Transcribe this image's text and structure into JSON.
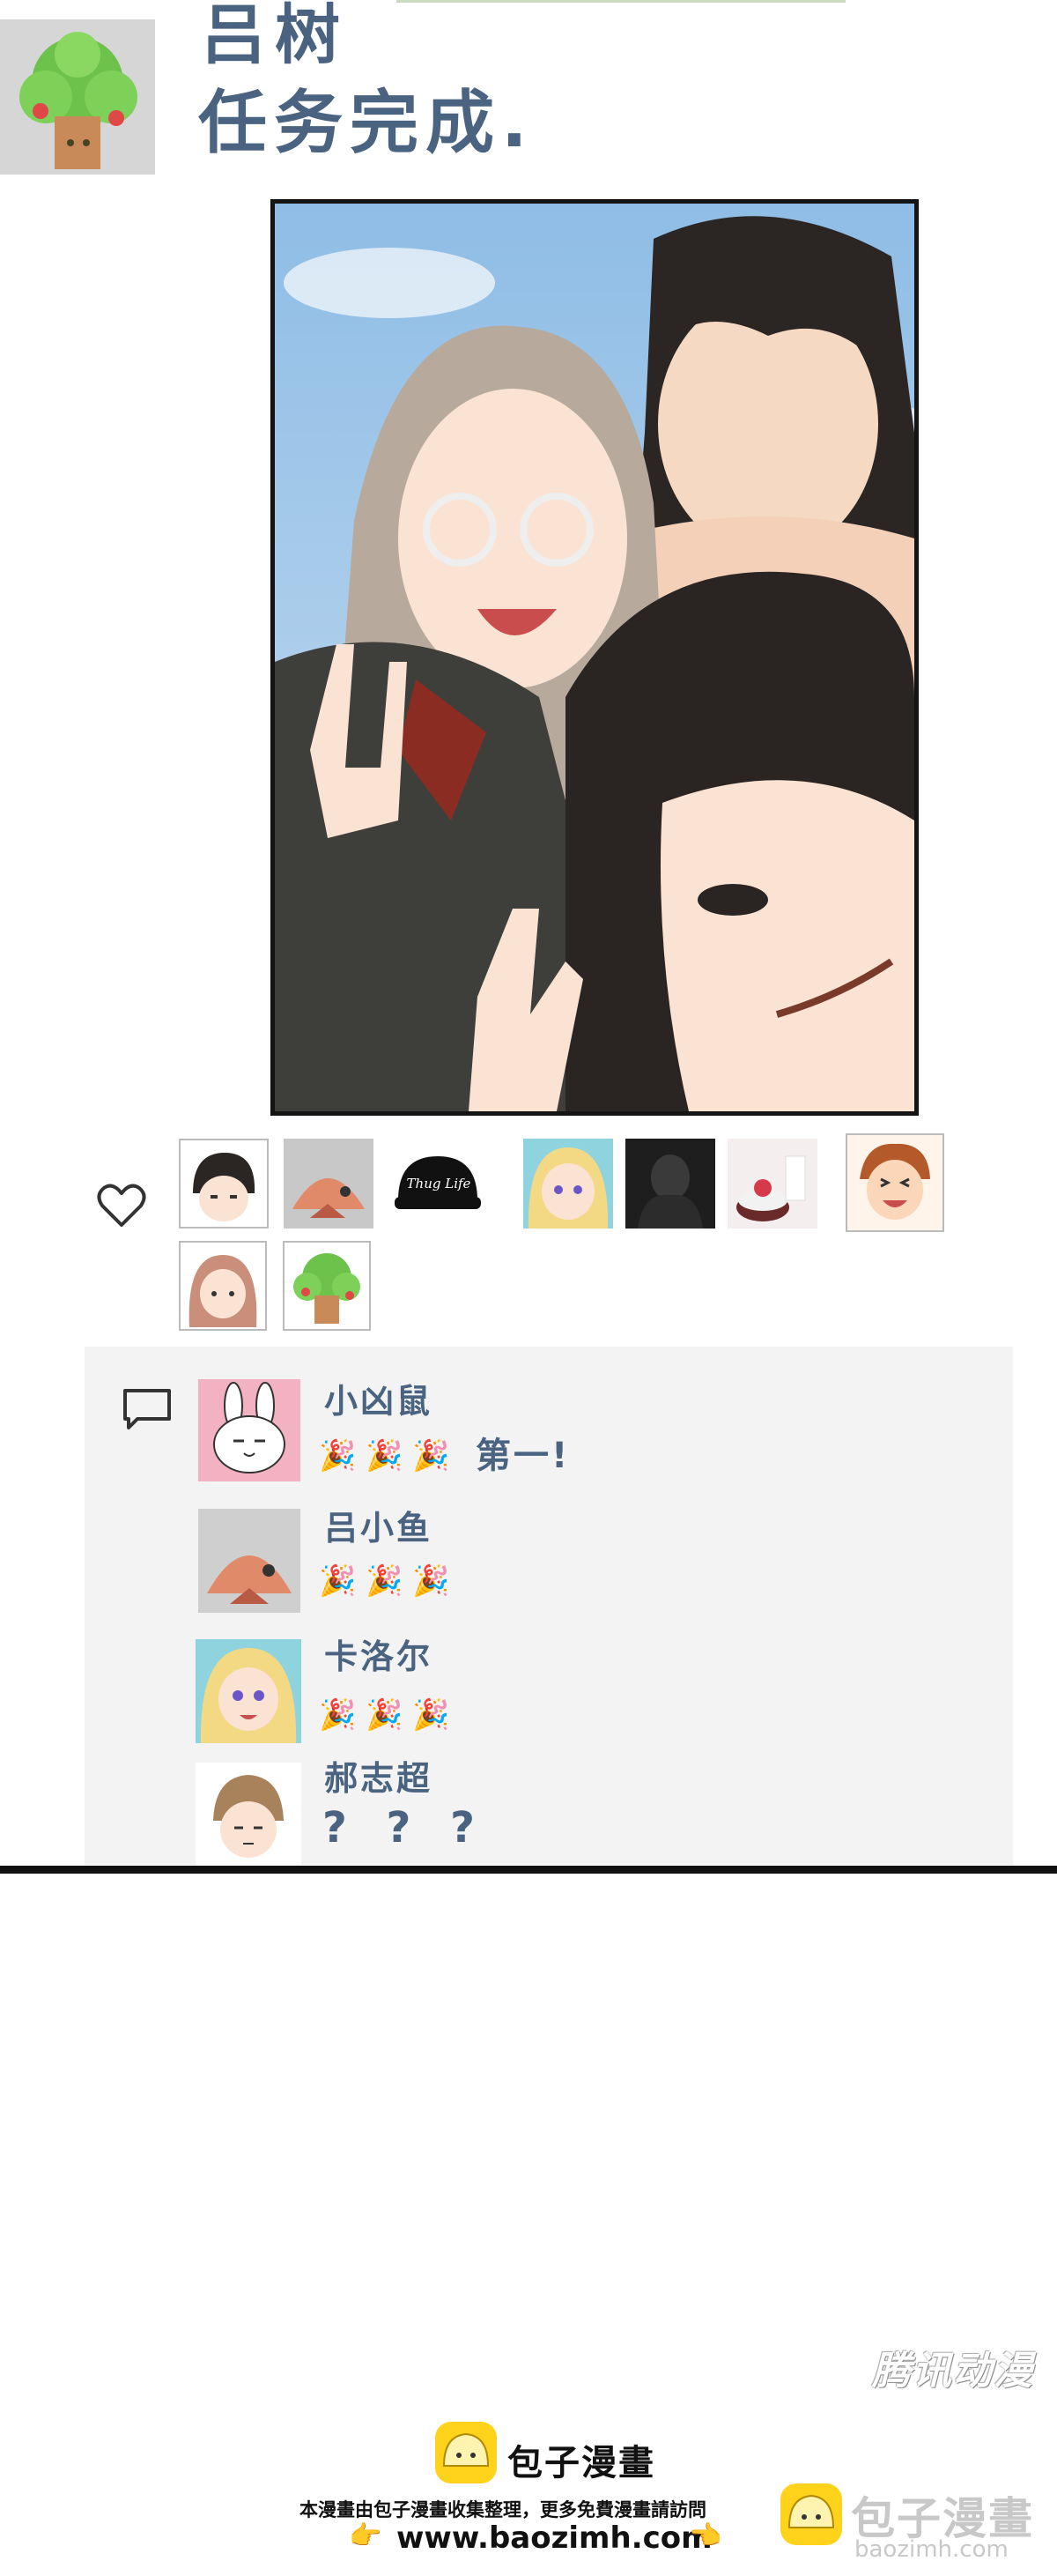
{
  "post": {
    "author": "吕树",
    "text": "任务完成."
  },
  "likes": {
    "icon": "heart-outline",
    "thumbs": [
      {
        "name": "like-avatar-boy"
      },
      {
        "name": "like-avatar-fish"
      },
      {
        "name": "like-avatar-thug-life-cap",
        "label": "Thug Life"
      },
      {
        "name": "like-avatar-blonde"
      },
      {
        "name": "like-avatar-dark-figure"
      },
      {
        "name": "like-avatar-cake"
      },
      {
        "name": "like-avatar-laughing-boy"
      },
      {
        "name": "like-avatar-girl"
      },
      {
        "name": "like-avatar-tree"
      }
    ]
  },
  "comments": [
    {
      "name": "小凶鼠",
      "text": "第一!",
      "emoji": "🎉 🎉 🎉"
    },
    {
      "name": "吕小鱼",
      "text": "",
      "emoji": "🎉 🎉 🎉"
    },
    {
      "name": "卡洛尔",
      "text": "",
      "emoji": "🎉 🎉 🎉"
    },
    {
      "name": "郝志超",
      "text": "? ? ?",
      "emoji": ""
    }
  ],
  "watermark": "腾讯动漫",
  "footer": {
    "brand": "包子漫畫",
    "note": "本漫畫由包子漫畫收集整理，更多免費漫畫請訪問",
    "url": "www.baozimh.com",
    "corner_brand": "包子漫畫",
    "corner_url": "baozimh.com"
  },
  "colors": {
    "accent_text": "#4a6380",
    "panel_bg": "#f3f3f3",
    "logo_yellow": "#ffd21c"
  }
}
